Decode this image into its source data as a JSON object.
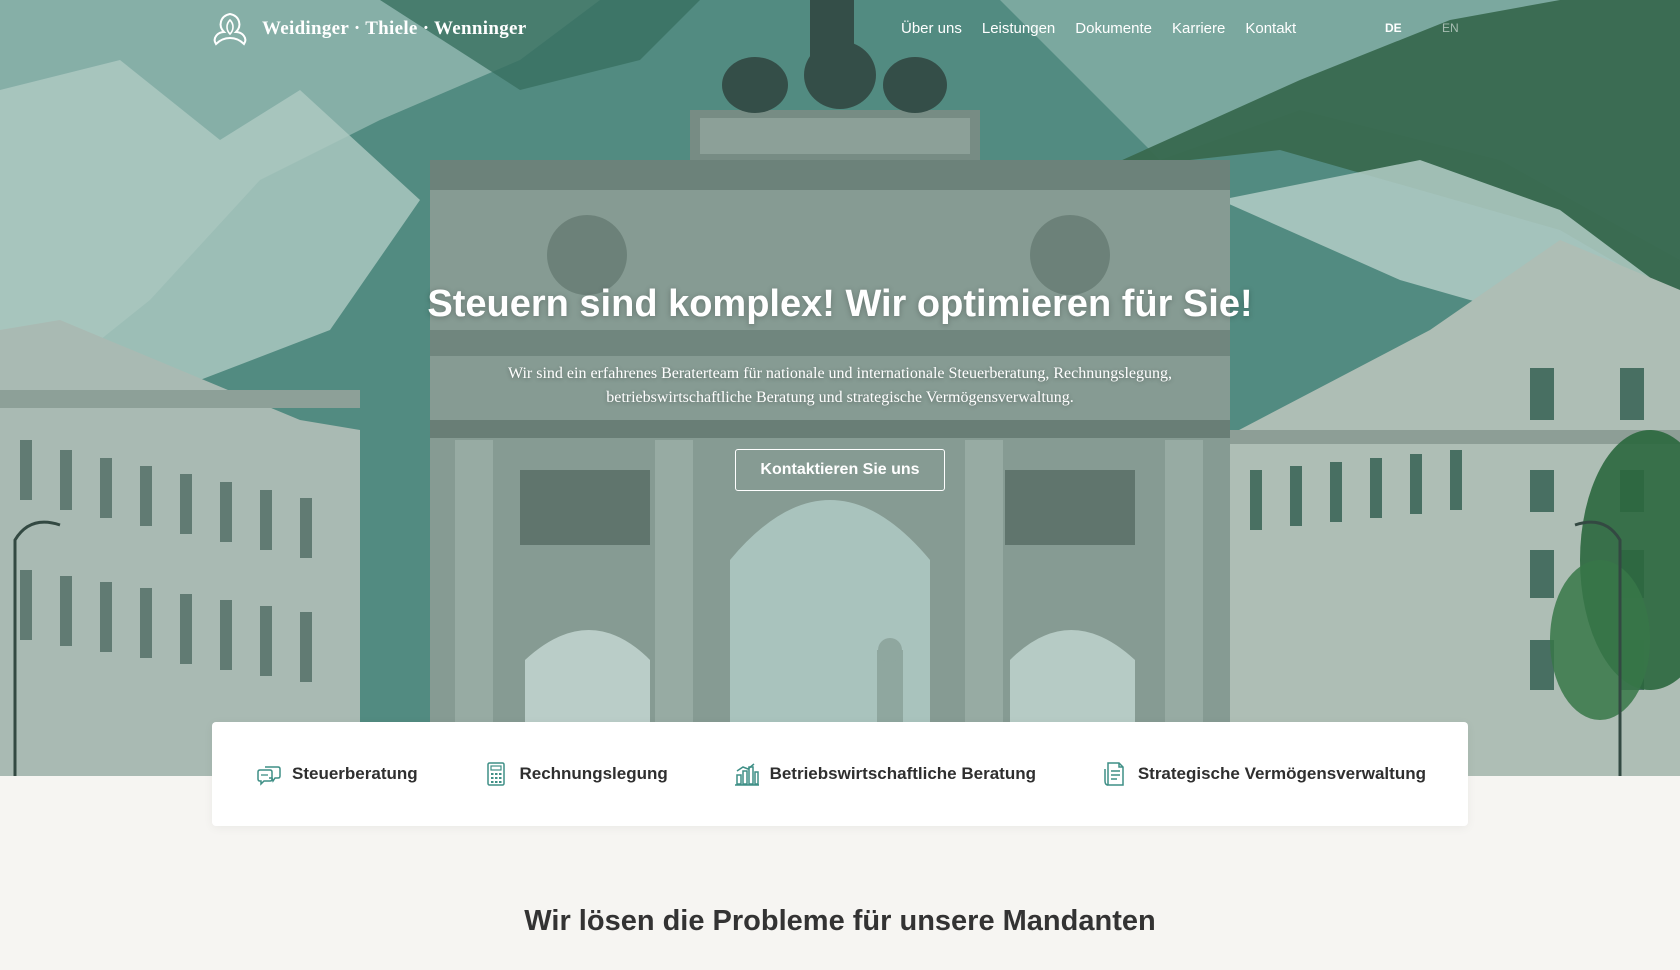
{
  "header": {
    "logo_text": "Weidinger · Thiele · Wenninger",
    "nav": [
      "Über uns",
      "Leistungen",
      "Dokumente",
      "Karriere",
      "Kontakt"
    ],
    "lang_active": "DE",
    "lang_other": "EN"
  },
  "hero": {
    "title": "Steuern sind komplex! Wir optimieren für Sie!",
    "subtitle": "Wir sind ein erfahrenes Beraterteam für nationale und internationale Steuerberatung, Rechnungslegung, betriebswirtschaftliche Beratung und strategische Vermögensverwaltung.",
    "cta_label": "Kontaktieren Sie uns"
  },
  "services": [
    {
      "label": "Steuerberatung",
      "icon": "speech-bubbles-icon"
    },
    {
      "label": "Rechnungslegung",
      "icon": "calculator-icon"
    },
    {
      "label": "Betriebswirtschaftliche Beratung",
      "icon": "bar-chart-icon"
    },
    {
      "label": "Strategische Vermögensverwaltung",
      "icon": "document-icon"
    }
  ],
  "section": {
    "title": "Wir lösen die Probleme für unsere Mandanten"
  },
  "colors": {
    "accent_teal": "#3f8f86",
    "hero_tint": "#2e6e64",
    "text_dark": "#2f2f2f",
    "page_bg": "#f6f5f2"
  }
}
